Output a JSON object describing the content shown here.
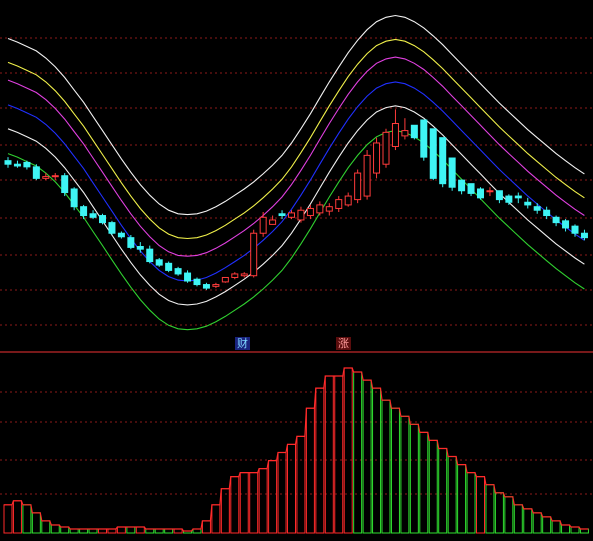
{
  "colors": {
    "background": "#000000",
    "grid": "#8b1a1a",
    "divider": "#c0282a",
    "up": "#ff3b3b",
    "down": "#3ff4f4",
    "outer_band": "#f2f2f2",
    "yellow_band": "#f0f04a",
    "magenta_band": "#e040e0",
    "middle_line": "#2030ff",
    "white_lower_band": "#f0f0f0",
    "green_lower_band": "#30d030",
    "vol_up": "#ff2a2a",
    "vol_down": "#30e030",
    "tag_blue_bg": "#1a237e",
    "tag_blue_text": "#7fd6ff",
    "tag_red_bg": "#5a0d0d",
    "tag_red_text": "#ff9a9a"
  },
  "tags": {
    "cai": "财",
    "zhang": "涨"
  },
  "chart_data": [
    {
      "type": "candlestick",
      "x": [
        1,
        2,
        3,
        4,
        5,
        6,
        7,
        8,
        9,
        10,
        11,
        12,
        13,
        14,
        15,
        16,
        17,
        18,
        19,
        20,
        21,
        22,
        23,
        24,
        25,
        26,
        27,
        28,
        29,
        30,
        31,
        32,
        33,
        34,
        35,
        36,
        37,
        38,
        39,
        40,
        41,
        42,
        43,
        44,
        45,
        46,
        47,
        48,
        49,
        50,
        51,
        52,
        53,
        54,
        55,
        56,
        57,
        58,
        59,
        60,
        61,
        62
      ],
      "open": [
        92,
        88,
        90,
        85,
        72,
        74,
        75,
        60,
        40,
        32,
        30,
        22,
        10,
        5,
        -5,
        -8,
        -20,
        -24,
        -30,
        -35,
        -42,
        -48,
        -50,
        -45,
        -40,
        -38,
        -38,
        10,
        20,
        32,
        28,
        25,
        30,
        33,
        35,
        38,
        42,
        48,
        52,
        78,
        88,
        108,
        120,
        132,
        138,
        128,
        118,
        95,
        70,
        66,
        60,
        58,
        58,
        52,
        52,
        45,
        40,
        36,
        28,
        24,
        18,
        10
      ],
      "close": [
        88,
        86,
        85,
        72,
        74,
        75,
        56,
        40,
        30,
        28,
        22,
        10,
        6,
        -6,
        -8,
        -22,
        -26,
        -32,
        -36,
        -44,
        -48,
        -52,
        -48,
        -40,
        -36,
        -36,
        10,
        28,
        25,
        30,
        33,
        36,
        38,
        42,
        40,
        48,
        52,
        78,
        98,
        112,
        124,
        134,
        126,
        118,
        96,
        72,
        66,
        62,
        58,
        55,
        50,
        58,
        48,
        45,
        50,
        42,
        36,
        30,
        22,
        16,
        10,
        5
      ],
      "high": [
        96,
        92,
        92,
        88,
        78,
        78,
        78,
        62,
        42,
        36,
        32,
        24,
        12,
        8,
        0,
        -4,
        -18,
        -22,
        -28,
        -32,
        -40,
        -46,
        -46,
        -40,
        -34,
        -34,
        14,
        34,
        30,
        36,
        36,
        40,
        42,
        46,
        44,
        52,
        56,
        82,
        104,
        118,
        128,
        150,
        140,
        126,
        124,
        98,
        72,
        72,
        68,
        62,
        62,
        62,
        58,
        54,
        56,
        50,
        44,
        40,
        30,
        26,
        20,
        14
      ],
      "low": [
        84,
        84,
        82,
        70,
        70,
        70,
        52,
        36,
        26,
        26,
        20,
        8,
        4,
        -8,
        -12,
        -24,
        -28,
        -34,
        -38,
        -46,
        -50,
        -54,
        -52,
        -46,
        -42,
        -40,
        -40,
        6,
        20,
        26,
        26,
        22,
        26,
        30,
        30,
        34,
        40,
        44,
        48,
        72,
        84,
        104,
        116,
        116,
        92,
        70,
        62,
        58,
        54,
        52,
        48,
        52,
        44,
        42,
        44,
        38,
        32,
        26,
        18,
        12,
        6,
        2
      ]
    },
    {
      "type": "line",
      "series": [
        {
          "values": [
            230,
            226,
            221,
            216,
            208,
            198,
            186,
            172,
            158,
            142,
            126,
            110,
            94,
            79,
            65,
            53,
            43,
            36,
            32,
            31,
            32,
            35,
            40,
            46,
            53,
            60,
            68,
            77,
            87,
            98,
            112,
            128,
            145,
            163,
            181,
            198,
            214,
            228,
            240,
            249,
            254,
            256,
            254,
            249,
            242,
            233,
            223,
            212,
            201,
            190,
            179,
            168,
            157,
            147,
            137,
            127,
            118,
            109,
            100,
            92,
            84,
            77
          ]
        },
        {
          "values": [
            203,
            199,
            194,
            189,
            181,
            171,
            159,
            145,
            131,
            115,
            99,
            83,
            67,
            52,
            38,
            26,
            16,
            9,
            5,
            4,
            5,
            8,
            13,
            19,
            26,
            33,
            41,
            50,
            60,
            71,
            85,
            101,
            118,
            136,
            154,
            171,
            187,
            201,
            213,
            222,
            227,
            229,
            227,
            222,
            215,
            206,
            196,
            185,
            174,
            163,
            152,
            141,
            130,
            120,
            110,
            100,
            91,
            82,
            73,
            65,
            57,
            50
          ]
        },
        {
          "values": [
            183,
            179,
            174,
            169,
            161,
            151,
            139,
            125,
            111,
            95,
            79,
            63,
            47,
            32,
            18,
            6,
            -4,
            -11,
            -15,
            -16,
            -15,
            -12,
            -7,
            -1,
            6,
            13,
            21,
            30,
            40,
            51,
            65,
            81,
            98,
            116,
            134,
            151,
            167,
            181,
            193,
            202,
            207,
            209,
            207,
            202,
            195,
            186,
            176,
            165,
            154,
            143,
            132,
            121,
            110,
            100,
            90,
            80,
            71,
            62,
            53,
            45,
            37,
            30
          ]
        },
        {
          "values": [
            155,
            151,
            146,
            141,
            133,
            123,
            111,
            97,
            83,
            67,
            51,
            35,
            19,
            4,
            -10,
            -22,
            -32,
            -39,
            -43,
            -44,
            -43,
            -40,
            -35,
            -29,
            -22,
            -15,
            -7,
            2,
            12,
            23,
            37,
            53,
            70,
            88,
            106,
            123,
            139,
            153,
            165,
            174,
            179,
            181,
            179,
            174,
            167,
            158,
            148,
            137,
            126,
            115,
            104,
            93,
            82,
            72,
            62,
            52,
            43,
            34,
            25,
            17,
            9,
            2
          ]
        },
        {
          "values": [
            128,
            124,
            119,
            114,
            106,
            96,
            84,
            70,
            56,
            40,
            24,
            8,
            -8,
            -23,
            -37,
            -49,
            -59,
            -66,
            -70,
            -71,
            -70,
            -67,
            -62,
            -56,
            -49,
            -42,
            -34,
            -25,
            -15,
            -4,
            10,
            26,
            43,
            61,
            79,
            96,
            112,
            126,
            138,
            147,
            152,
            154,
            152,
            147,
            140,
            131,
            121,
            110,
            99,
            88,
            77,
            66,
            55,
            45,
            35,
            25,
            16,
            7,
            -2,
            -10,
            -18,
            -25
          ]
        },
        {
          "values": [
            100,
            96,
            91,
            86,
            78,
            68,
            56,
            42,
            28,
            12,
            -4,
            -20,
            -36,
            -51,
            -65,
            -77,
            -87,
            -94,
            -98,
            -99,
            -98,
            -95,
            -90,
            -84,
            -77,
            -70,
            -62,
            -53,
            -43,
            -32,
            -18,
            -2,
            15,
            33,
            51,
            68,
            84,
            98,
            110,
            119,
            124,
            126,
            124,
            119,
            112,
            103,
            93,
            82,
            71,
            60,
            49,
            38,
            27,
            17,
            7,
            -3,
            -12,
            -21,
            -30,
            -38,
            -46,
            -53
          ]
        }
      ]
    },
    {
      "type": "bar",
      "values": [
        14,
        16,
        14,
        10,
        6,
        4,
        3,
        2,
        2,
        2,
        2,
        2,
        3,
        3,
        3,
        2,
        2,
        2,
        2,
        1,
        2,
        6,
        14,
        22,
        28,
        30,
        30,
        32,
        36,
        40,
        44,
        48,
        62,
        72,
        78,
        78,
        82,
        80,
        76,
        72,
        66,
        62,
        58,
        54,
        50,
        46,
        42,
        38,
        34,
        30,
        28,
        24,
        20,
        18,
        14,
        12,
        10,
        8,
        6,
        4,
        3,
        2
      ],
      "up": [
        true,
        true,
        false,
        false,
        false,
        false,
        false,
        false,
        false,
        false,
        true,
        true,
        true,
        false,
        true,
        false,
        false,
        false,
        true,
        false,
        false,
        true,
        true,
        true,
        true,
        true,
        true,
        true,
        true,
        true,
        true,
        true,
        true,
        true,
        true,
        true,
        true,
        false,
        false,
        false,
        false,
        false,
        false,
        false,
        false,
        false,
        false,
        false,
        false,
        false,
        true,
        false,
        false,
        false,
        false,
        false,
        false,
        false,
        false,
        false,
        false,
        false
      ],
      "ylim": [
        0,
        80
      ]
    }
  ]
}
